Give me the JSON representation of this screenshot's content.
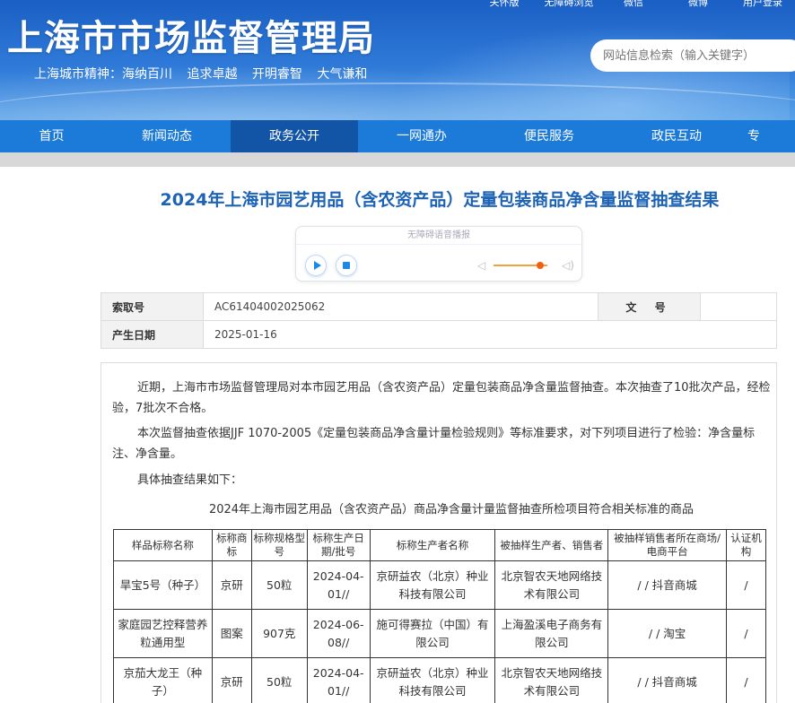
{
  "header": {
    "title": "上海市市场监督管理局",
    "motto": "上海城市精神：海纳百川  追求卓越  开明睿智  大气谦和",
    "toplinks": [
      "关怀版",
      "无障碍浏览",
      "微信",
      "微博",
      "用户登录"
    ],
    "search_placeholder": "网站信息检索（输入关键字）"
  },
  "nav": {
    "items": [
      "首页",
      "新闻动态",
      "政务公开",
      "一网通办",
      "便民服务",
      "政民互动",
      "专"
    ],
    "active": "政务公开"
  },
  "article": {
    "title": "2024年上海市园艺用品（含农资产品）定量包装商品净含量监督抽查结果",
    "player_title": "无障碍语音播报",
    "meta": {
      "index_label": "索取号",
      "index_value": "AC61404002025062",
      "docno_label": "文 号",
      "docno_value": "",
      "date_label": "产生日期",
      "date_value": "2025-01-16"
    },
    "paragraphs": [
      "近期，上海市市场监督管理局对本市园艺用品（含农资产品）定量包装商品净含量监督抽查。本次抽查了10批次产品，经检验，7批次不合格。",
      "本次监督抽查依据JJF 1070-2005《定量包装商品净含量计量检验规则》等标准要求，对下列项目进行了检验：净含量标注、净含量。",
      "具体抽查结果如下："
    ],
    "table_caption": "2024年上海市园艺用品（含农资产品）商品净含量计量监督抽查所检项目符合相关标准的商品",
    "table": {
      "headers": [
        "样品标称名称",
        "标称商标",
        "标称规格型号",
        "标称生产日期/批号",
        "标称生产者名称",
        "被抽样生产者、销售者",
        "被抽样销售者所在商场/电商平台",
        "认证机构"
      ],
      "rows": [
        [
          "旱宝5号（种子）",
          "京研",
          "50粒",
          "2024-04-01//",
          "京研益农（北京）种业科技有限公司",
          "北京智农天地网络技术有限公司",
          "/ / 抖音商城",
          "/"
        ],
        [
          "家庭园艺控释营养粒通用型",
          "图案",
          "907克",
          "2024-06-08//",
          "施可得赛拉（中国）有限公司",
          "上海盈溪电子商务有限公司",
          "/ / 淘宝",
          "/"
        ],
        [
          "京茄大龙王（种子）",
          "京研",
          "50粒",
          "2024-04-01//",
          "京研益农（北京）种业科技有限公司",
          "北京智农天地网络技术有限公司",
          "/ / 抖音商城",
          "/"
        ]
      ]
    }
  },
  "colors": {
    "header_blue": "#1a5fc4",
    "nav_blue": "#1c7ad8",
    "nav_active": "#1255a6",
    "title_blue": "#1d63b5",
    "slider_orange": "#f06010"
  },
  "player": {
    "volume_fraction": 0.8,
    "icons": [
      "play-icon",
      "stop-icon",
      "volume-low-icon",
      "volume-high-icon"
    ]
  }
}
